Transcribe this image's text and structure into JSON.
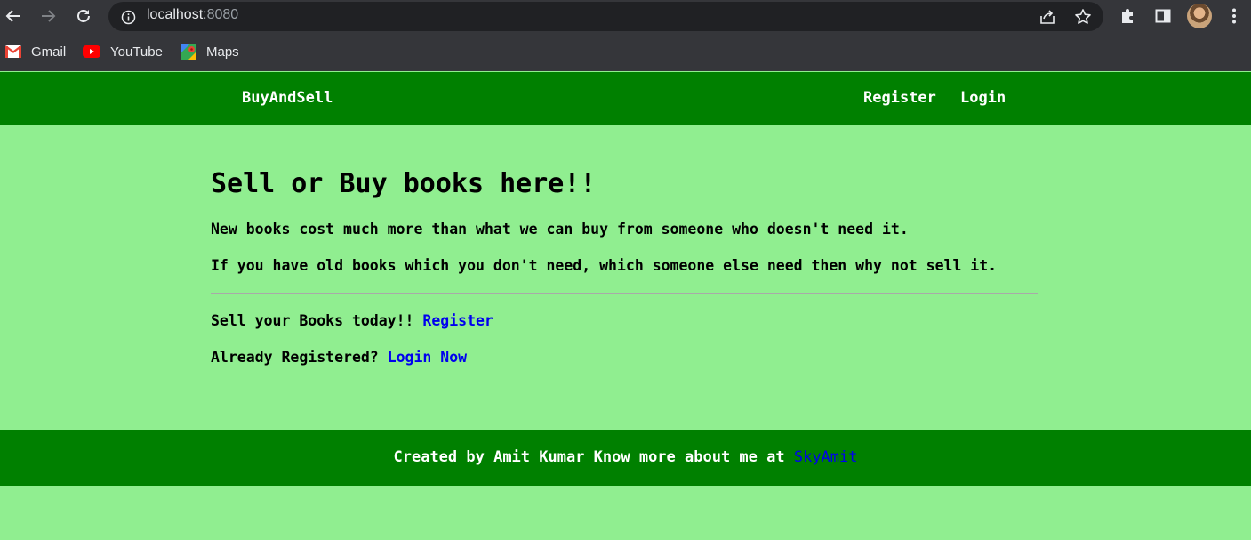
{
  "browser": {
    "url_host": "localhost",
    "url_port": ":8080",
    "bookmarks": [
      {
        "label": "Gmail",
        "icon": "gmail-icon"
      },
      {
        "label": "YouTube",
        "icon": "youtube-icon"
      },
      {
        "label": "Maps",
        "icon": "maps-icon"
      }
    ]
  },
  "navbar": {
    "brand": "BuyAndSell",
    "register": "Register",
    "login": "Login"
  },
  "main": {
    "headline": "Sell or Buy books here!!",
    "paragraph1": "New books cost much more than what we can buy from someone who doesn't need it.",
    "paragraph2": "If you have old books which you don't need, which someone else need then why not sell it.",
    "cta_register_text": "Sell your Books today!! ",
    "cta_register_link": "Register",
    "cta_login_text": "Already Registered? ",
    "cta_login_link": "Login Now"
  },
  "footer": {
    "text": "Created by Amit Kumar Know more about me at ",
    "link": "SkyAmit"
  },
  "colors": {
    "navbar_bg": "#008000",
    "page_bg": "#90ee90",
    "link": "#0000ee"
  }
}
